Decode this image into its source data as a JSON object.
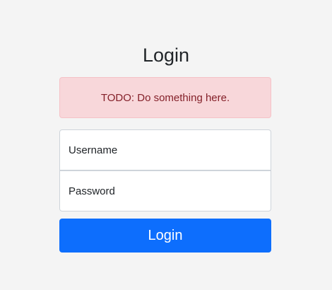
{
  "page": {
    "title": "Login"
  },
  "alert": {
    "text": "TODO: Do something here."
  },
  "form": {
    "username_placeholder": "Username",
    "password_placeholder": "Password",
    "submit_label": "Login"
  },
  "colors": {
    "background": "#f4f4f4",
    "alert_background": "#f8d7da",
    "alert_border": "#f5c2c7",
    "alert_text": "#842029",
    "primary": "#0d6efd",
    "field_border": "#ced4da"
  }
}
